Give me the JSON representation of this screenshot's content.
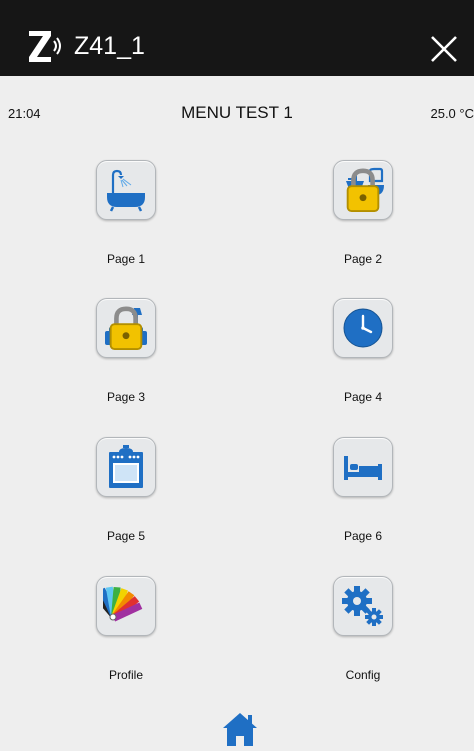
{
  "header": {
    "app_title": "Z41_1",
    "logo_icon": "z-wave-logo-icon",
    "close_icon": "close-icon"
  },
  "status": {
    "time": "21:04",
    "menu_title": "MENU TEST 1",
    "temperature": "25.0 °C"
  },
  "tiles": [
    {
      "label": "Page 1",
      "icon": "bathtub-icon",
      "locked": false
    },
    {
      "label": "Page 2",
      "icon": "bathroom-fixtures-icon",
      "locked": true
    },
    {
      "label": "Page 3",
      "icon": "living-room-sofa-icon",
      "locked": true
    },
    {
      "label": "Page 4",
      "icon": "clock-icon",
      "locked": false
    },
    {
      "label": "Page 5",
      "icon": "kitchen-oven-icon",
      "locked": false
    },
    {
      "label": "Page 6",
      "icon": "bedroom-bed-icon",
      "locked": false
    },
    {
      "label": "Profile",
      "icon": "color-palette-icon",
      "locked": false
    },
    {
      "label": "Config",
      "icon": "gears-icon",
      "locked": false
    }
  ],
  "footer": {
    "home_icon": "home-icon"
  },
  "colors": {
    "topbar": "#161616",
    "background": "#eeeeee",
    "icon_blue": "#1f6fc4",
    "lock_yellow": "#f2c200"
  }
}
